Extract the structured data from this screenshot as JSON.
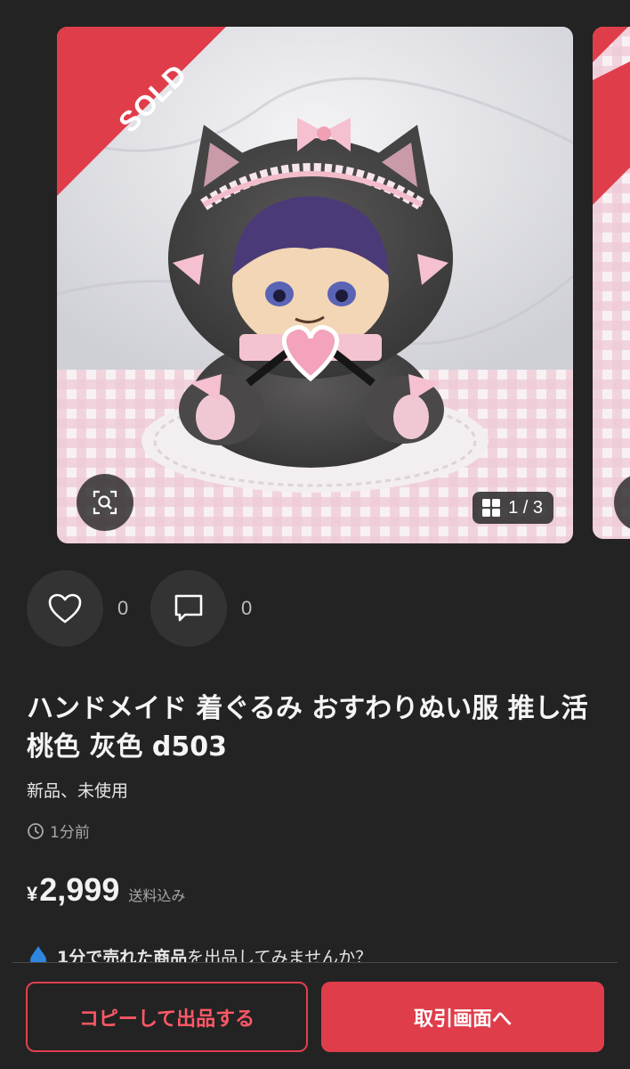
{
  "carousel": {
    "badge": "SOLD",
    "counter": "1 / 3",
    "icons": {
      "zoom": "zoom-search-icon",
      "grid": "grid-icon"
    }
  },
  "actions": {
    "like_count": "0",
    "comment_count": "0",
    "icons": {
      "like": "heart-icon",
      "comment": "comment-icon"
    }
  },
  "item": {
    "title": "ハンドメイド 着ぐるみ おすわりぬい服 推し活 桃色 灰色 d503",
    "condition": "新品、未使用",
    "posted": "1分前",
    "currency": "¥",
    "price": "2,999",
    "shipping": "送料込み"
  },
  "promo": {
    "highlight": "1分で売れた商品",
    "rest": "を出品してみませんか？",
    "icon": "drop-icon"
  },
  "bottom": {
    "copy_label": "コピーして出品する",
    "trade_label": "取引画面へ"
  },
  "colors": {
    "background": "#232323",
    "accent": "#e03d4b",
    "sold_ribbon": "#e03d4b"
  }
}
